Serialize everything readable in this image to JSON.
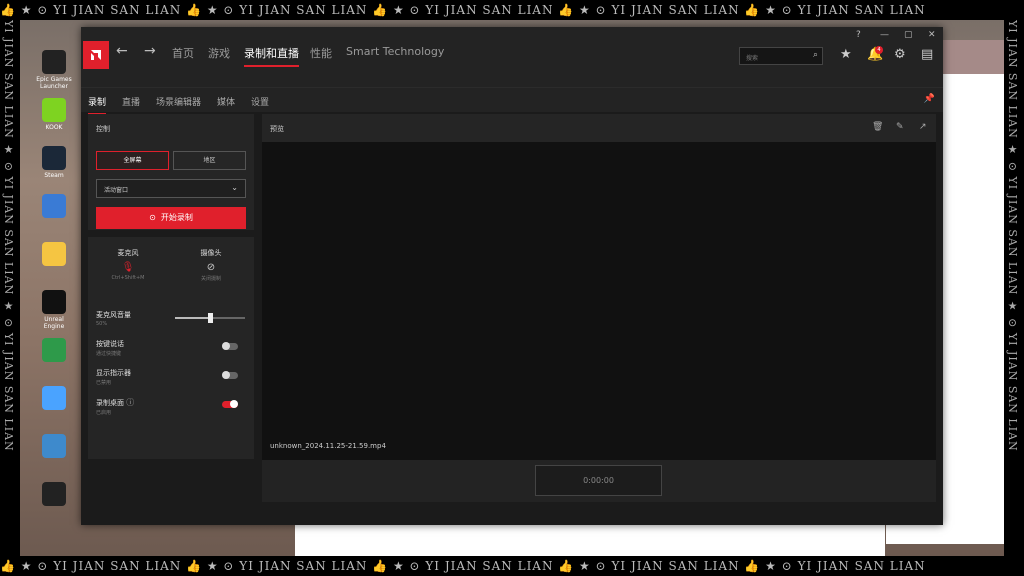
{
  "watermark": {
    "text": "👍 ★ ⊙ YI JIAN SAN LIAN  👍 ★ ⊙ YI JIAN SAN LIAN  👍 ★ ⊙ YI JIAN SAN LIAN  👍 ★ ⊙ YI JIAN SAN LIAN  👍 ★ ⊙ YI JIAN SAN LIAN",
    "vertical": "YI JIAN SAN LIAN ★ ⊙ YI JIAN SAN LIAN ★ ⊙ YI JIAN SAN LIAN"
  },
  "desktop": {
    "icons": [
      {
        "label": "Epic Games Launcher",
        "color": "#222222"
      },
      {
        "label": "KOOK",
        "color": "#7ed321"
      },
      {
        "label": "Steam",
        "color": "#1b2838"
      },
      {
        "label": "",
        "color": "#3a7bd5"
      },
      {
        "label": "",
        "color": "#f5c542"
      },
      {
        "label": "Unreal Engine",
        "color": "#111111"
      },
      {
        "label": "",
        "color": "#2e9a4a"
      },
      {
        "label": "",
        "color": "#4aa3ff"
      },
      {
        "label": "",
        "color": "#3e8acc"
      },
      {
        "label": "",
        "color": "#222222"
      }
    ]
  },
  "app": {
    "nav": {
      "home": "首页",
      "games": "游戏",
      "record": "录制和直播",
      "performance": "性能",
      "smart": "Smart Technology"
    },
    "search_placeholder": "搜索",
    "notification_count": "4",
    "subtabs": {
      "record": "录制",
      "stream": "直播",
      "scene": "场景编辑器",
      "media": "媒体",
      "settings": "设置"
    },
    "capture": {
      "title": "控制",
      "fullscreen": "全屏幕",
      "region": "地区",
      "window_select": "活动窗口",
      "start_record": "开始录制"
    },
    "devices": {
      "mic": "麦克风",
      "mic_hotkey": "Ctrl+Shift+M",
      "camera": "摄像头",
      "camera_status": "关闭摄制"
    },
    "options": {
      "mic_volume": "麦克风音量",
      "mic_volume_value": "50%",
      "mic_volume_level": 0.5,
      "push_to_talk": "按键说话",
      "push_to_talk_sub": "通过快捷键",
      "show_indicator": "显示指示器",
      "show_indicator_sub": "已禁用",
      "record_desktop": "录制桌面",
      "record_desktop_sub": "已启用"
    },
    "preview": {
      "title": "预览",
      "filename": "unknown_2024.11.25-21.59.mp4",
      "timer": "0:00:00"
    }
  },
  "colors": {
    "accent": "#e0202c",
    "background": "#1b1b1b"
  }
}
